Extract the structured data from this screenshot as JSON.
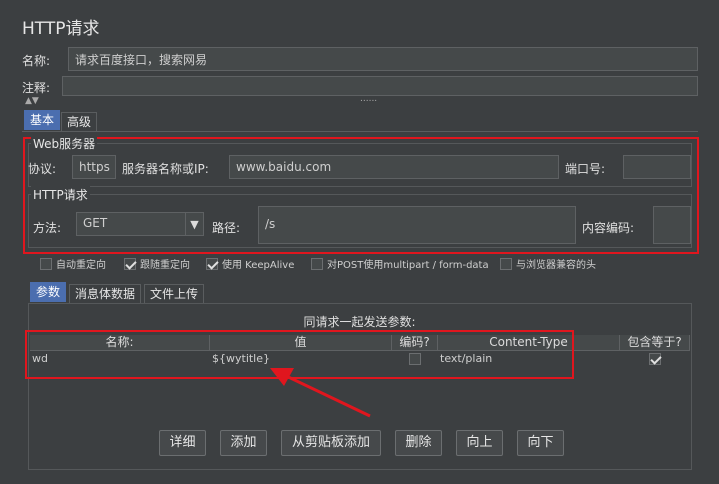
{
  "header": {
    "title": "HTTP请求"
  },
  "fields": {
    "name_label": "名称:",
    "name_value": "请求百度接口，搜索网易",
    "comment_label": "注释:",
    "comment_value": ""
  },
  "tabs": {
    "basic": "基本",
    "advanced": "高级"
  },
  "web_server": {
    "group_title": "Web服务器",
    "protocol_label": "协议:",
    "protocol_value": "https",
    "server_label": "服务器名称或IP:",
    "server_value": "www.baidu.com",
    "port_label": "端口号:",
    "port_value": ""
  },
  "http_request": {
    "group_title": "HTTP请求",
    "method_label": "方法:",
    "method_value": "GET",
    "path_label": "路径:",
    "path_value": "/s",
    "encoding_label": "内容编码:",
    "encoding_value": ""
  },
  "options": [
    {
      "label": "自动重定向",
      "checked": false
    },
    {
      "label": "跟随重定向",
      "checked": true
    },
    {
      "label": "使用 KeepAlive",
      "checked": true
    },
    {
      "label": "对POST使用multipart / form-data",
      "checked": false
    },
    {
      "label": "与浏览器兼容的头",
      "checked": false
    }
  ],
  "sub_tabs": {
    "params": "参数",
    "body": "消息体数据",
    "files": "文件上传"
  },
  "params_table": {
    "caption": "同请求一起发送参数:",
    "columns": [
      "名称:",
      "值",
      "编码?",
      "Content-Type",
      "包含等于?"
    ],
    "rows": [
      {
        "name": "wd",
        "value": "${wytitle}",
        "encode": false,
        "content_type": "text/plain",
        "include_equals": true
      }
    ]
  },
  "buttons": {
    "detail": "详细",
    "add": "添加",
    "add_clipboard": "从剪贴板添加",
    "delete": "删除",
    "up": "向上",
    "down": "向下"
  },
  "icons": {
    "dropdown": "▼",
    "collapse": "▲▼",
    "grip": "......"
  },
  "colors": {
    "highlight": "#e0161e",
    "active_tab": "#4b6eaf"
  }
}
